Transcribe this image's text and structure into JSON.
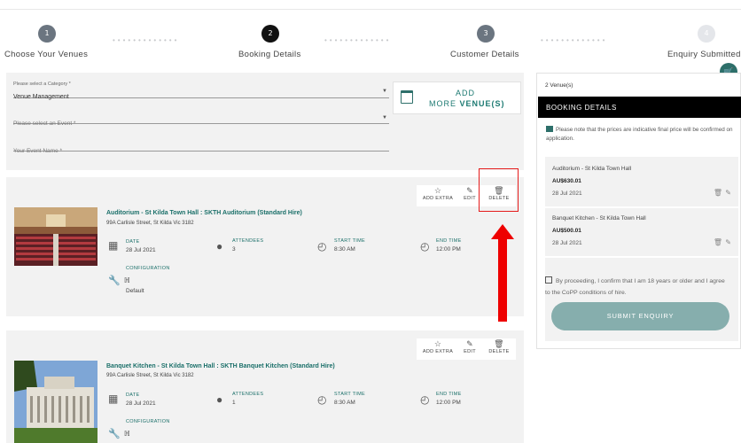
{
  "stepper": [
    {
      "num": "1",
      "label": "Choose Your Venues"
    },
    {
      "num": "2",
      "label": "Booking Details"
    },
    {
      "num": "3",
      "label": "Customer Details"
    },
    {
      "num": "4",
      "label": "Enquiry Submitted"
    }
  ],
  "form": {
    "category_label": "Please select a Category *",
    "category_value": "Venue Management",
    "event_placeholder": "Please select an Event *",
    "event_name_placeholder": "Your Event Name *",
    "add_more_line1": "ADD",
    "add_more_prefix": "MORE ",
    "add_more_bold": "VENUE(S)"
  },
  "venues": [
    {
      "title": "Auditorium - St Kilda Town Hall : SKTH Auditorium (Standard Hire)",
      "address": "99A Carlisle Street, St Kilda Vic 3182",
      "date_label": "DATE",
      "date": "28 Jul 2021",
      "attendees_label": "ATTENDEES",
      "attendees": "3",
      "start_label": "START TIME",
      "start": "8:30 AM",
      "end_label": "END TIME",
      "end": "12:00 PM",
      "config_label": "CONFIGURATION",
      "config": "Default",
      "add_extra": "ADD EXTRA",
      "edit": "EDIT",
      "delete": "DELETE"
    },
    {
      "title": "Banquet Kitchen - St Kilda Town Hall : SKTH Banquet Kitchen (Standard Hire)",
      "address": "99A Carlisle Street, St Kilda Vic 3182",
      "date_label": "DATE",
      "date": "28 Jul 2021",
      "attendees_label": "ATTENDEES",
      "attendees": "1",
      "start_label": "START TIME",
      "start": "8:30 AM",
      "end_label": "END TIME",
      "end": "12:00 PM",
      "config_label": "CONFIGURATION",
      "add_extra": "ADD EXTRA",
      "edit": "EDIT",
      "delete": "DELETE"
    }
  ],
  "summary": {
    "count": "2 Venue(s)",
    "header": "BOOKING DETAILS",
    "note": "Please note that the prices are indicative final price will be confirmed on application.",
    "items": [
      {
        "name": "Auditorium - St Kilda Town Hall",
        "price": "AU$630.01",
        "date": "28 Jul 2021"
      },
      {
        "name": "Banquet Kitchen - St Kilda Town Hall",
        "price": "AU$500.01",
        "date": "28 Jul 2021"
      }
    ],
    "confirm_text": "By proceeding, I confirm that I am 18 years or older and I agree to the CoPP conditions of hire.",
    "submit": "SUBMIT ENQUIRY"
  },
  "colors": {
    "accent": "#1a6f69",
    "submit": "#86aead",
    "annotation": "#e51b1b"
  }
}
